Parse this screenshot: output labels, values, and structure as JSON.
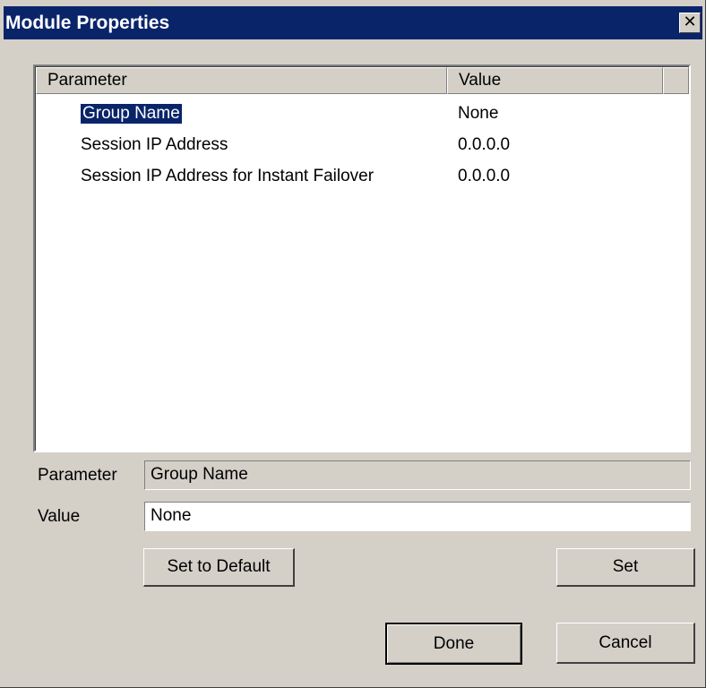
{
  "window": {
    "title": "Module Properties",
    "close_glyph": "✕"
  },
  "list": {
    "columns": [
      "Parameter",
      "Value"
    ],
    "rows": [
      {
        "parameter": "Group Name",
        "value": "None",
        "selected": true
      },
      {
        "parameter": "Session IP Address",
        "value": "0.0.0.0",
        "selected": false
      },
      {
        "parameter": "Session IP Address for Instant Failover",
        "value": "0.0.0.0",
        "selected": false
      }
    ]
  },
  "form": {
    "parameter_label": "Parameter",
    "parameter_value": "Group Name",
    "value_label": "Value",
    "value_value": "None"
  },
  "buttons": {
    "set_default": "Set to Default",
    "set": "Set",
    "done": "Done",
    "cancel": "Cancel"
  },
  "colors": {
    "titlebar": "#0a246a",
    "face": "#d4d0c8",
    "selection": "#0a246a"
  }
}
